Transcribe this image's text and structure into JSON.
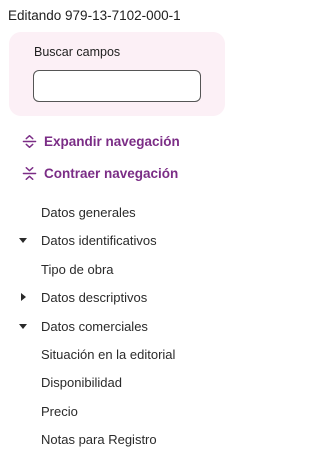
{
  "header": {
    "title": "Editando 979-13-7102-000-1"
  },
  "search": {
    "label": "Buscar campos",
    "value": "",
    "placeholder": ""
  },
  "actions": {
    "expand_label": "Expandir navegación",
    "collapse_label": "Contraer navegación"
  },
  "colors": {
    "accent": "#7b2d86",
    "search_bg": "#fcf0f6"
  },
  "tree": [
    {
      "label": "Datos generales",
      "type": "leaf"
    },
    {
      "label": "Datos identificativos",
      "type": "group",
      "state": "expanded",
      "icon": "caret-down-icon"
    },
    {
      "label": "Tipo de obra",
      "type": "leaf"
    },
    {
      "label": "Datos descriptivos",
      "type": "group",
      "state": "collapsed",
      "icon": "caret-right-icon"
    },
    {
      "label": "Datos comerciales",
      "type": "group",
      "state": "expanded",
      "icon": "caret-down-icon"
    },
    {
      "label": "Situación en la editorial",
      "type": "leaf"
    },
    {
      "label": "Disponibilidad",
      "type": "leaf"
    },
    {
      "label": "Precio",
      "type": "leaf"
    },
    {
      "label": "Notas para Registro",
      "type": "leaf"
    }
  ]
}
